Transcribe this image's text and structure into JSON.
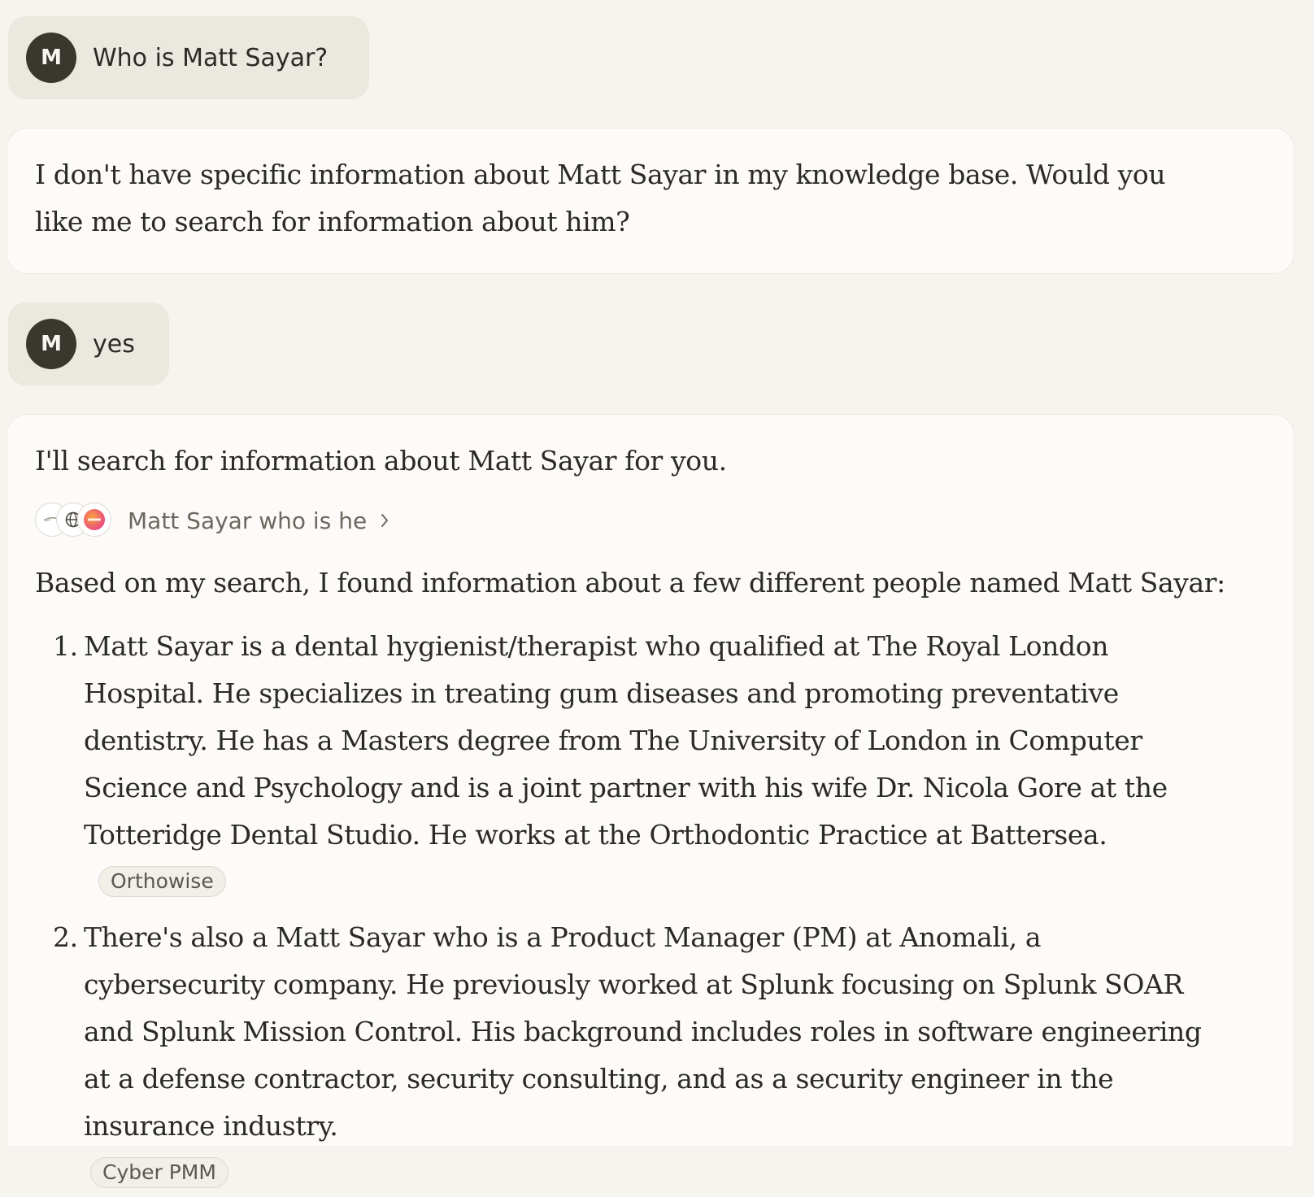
{
  "conversation": {
    "user_avatar_initial": "M",
    "message1": {
      "text": "Who is Matt Sayar?"
    },
    "reply1": {
      "text": "I don't have specific information about Matt Sayar in my knowledge base. Would you like me to search for information about him?"
    },
    "message2": {
      "text": "yes"
    },
    "reply2": {
      "intro": "I'll search for information about Matt Sayar for you.",
      "search": {
        "query": "Matt Sayar who is he",
        "source_icons": [
          "feather-icon",
          "globe-icon",
          "splunk-icon"
        ]
      },
      "summary": "Based on my search, I found information about a few different people named Matt Sayar:",
      "items": [
        {
          "number": "1.",
          "text": "Matt Sayar is a dental hygienist/therapist who qualified at The Royal London Hospital. He specializes in treating gum diseases and promoting preventative dentistry. He has a Masters degree from The University of London in Computer Science and Psychology and is a joint partner with his wife Dr. Nicola Gore at the Totteridge Dental Studio. He works at the Orthodontic Practice at Battersea.",
          "citation": "Orthowise"
        },
        {
          "number": "2.",
          "text": "There's also a Matt Sayar who is a Product Manager (PM) at Anomali, a cybersecurity company. He previously worked at Splunk focusing on Splunk SOAR and Splunk Mission Control. His background includes roles in software engineering at a defense contractor, security consulting, and as a security engineer in the insurance industry.",
          "citation": "Cyber PMM"
        }
      ]
    }
  },
  "colors": {
    "page_bg": "#f6f4ef",
    "user_bubble": "#ebe8e0",
    "avatar_bg": "#3a372f",
    "card_bg": "#fcfbf9",
    "splunk_accent": "#f0563a"
  }
}
